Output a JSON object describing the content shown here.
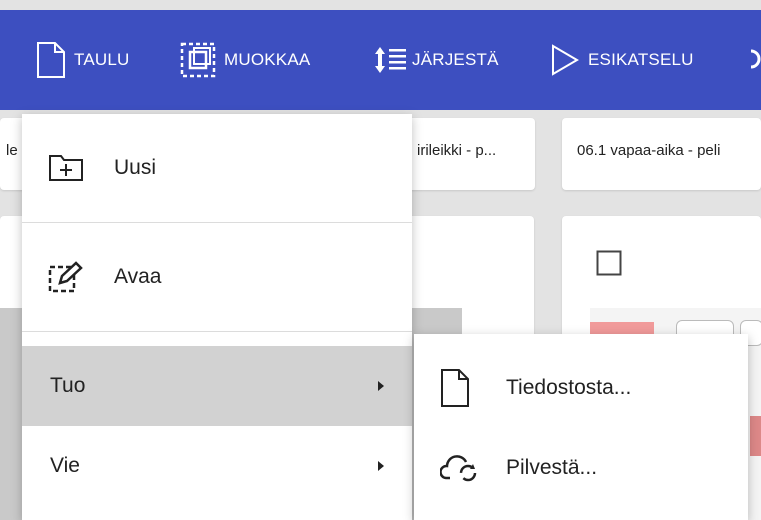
{
  "toolbar": {
    "items": [
      {
        "label": "TAULU",
        "icon": "page-icon"
      },
      {
        "label": "MUOKKAA",
        "icon": "edit-frame-icon"
      },
      {
        "label": "JÄRJESTÄ",
        "icon": "sort-icon"
      },
      {
        "label": "ESIKATSELU",
        "icon": "play-icon"
      }
    ]
  },
  "cards": {
    "card1_text": "le",
    "card2_text": "irileikki - p...",
    "card3_text": "06.1 vapaa-aika - peli"
  },
  "menu": {
    "items": [
      {
        "label": "Uusi",
        "icon": "new-folder-icon"
      },
      {
        "label": "Avaa",
        "icon": "open-edit-icon"
      },
      {
        "label": "Tuo",
        "icon": "",
        "submenu": true
      },
      {
        "label": "Vie",
        "icon": "",
        "submenu": true
      }
    ]
  },
  "submenu": {
    "items": [
      {
        "label": "Tiedostosta...",
        "icon": "file-icon"
      },
      {
        "label": "Pilvestä...",
        "icon": "cloud-sync-icon"
      }
    ]
  },
  "colors": {
    "toolbar_bg": "#3d4fc0",
    "menu_active_bg": "#d2d2d2"
  }
}
